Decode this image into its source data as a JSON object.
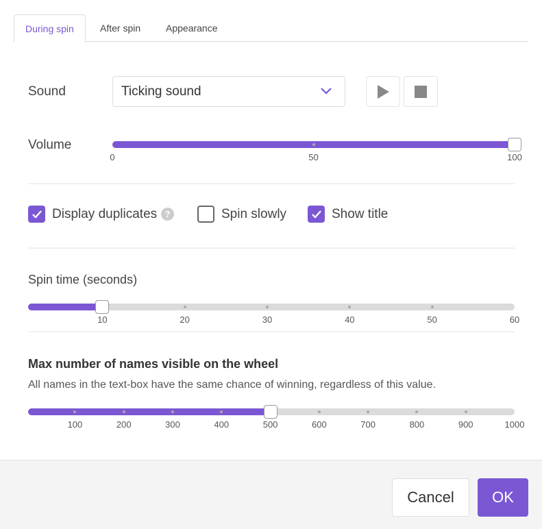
{
  "tabs": [
    {
      "label": "During spin",
      "active": true
    },
    {
      "label": "After spin",
      "active": false
    },
    {
      "label": "Appearance",
      "active": false
    }
  ],
  "sound": {
    "label": "Sound",
    "value": "Ticking sound",
    "play_icon": "play-icon",
    "stop_icon": "stop-icon"
  },
  "volume": {
    "label": "Volume",
    "min": 0,
    "max": 100,
    "value": 100,
    "ticks": [
      "0",
      "50",
      "100"
    ]
  },
  "checkboxes": [
    {
      "label": "Display duplicates",
      "checked": true,
      "help_icon": "question-circle-icon"
    },
    {
      "label": "Spin slowly",
      "checked": false
    },
    {
      "label": "Show title",
      "checked": true
    }
  ],
  "spin_time": {
    "label": "Spin time (seconds)",
    "min": 1,
    "max": 60,
    "value": 10,
    "ticks": [
      "10",
      "20",
      "30",
      "40",
      "50",
      "60"
    ]
  },
  "max_names": {
    "title": "Max number of names visible on the wheel",
    "description": "All names in the text-box have the same chance of winning, regardless of this value.",
    "min": 4,
    "max": 1000,
    "value": 500,
    "ticks": [
      "100",
      "200",
      "300",
      "400",
      "500",
      "600",
      "700",
      "800",
      "900",
      "1000"
    ]
  },
  "footer": {
    "cancel": "Cancel",
    "ok": "OK"
  },
  "colors": {
    "accent": "#7b57d3",
    "track": "#dbdbdb"
  }
}
